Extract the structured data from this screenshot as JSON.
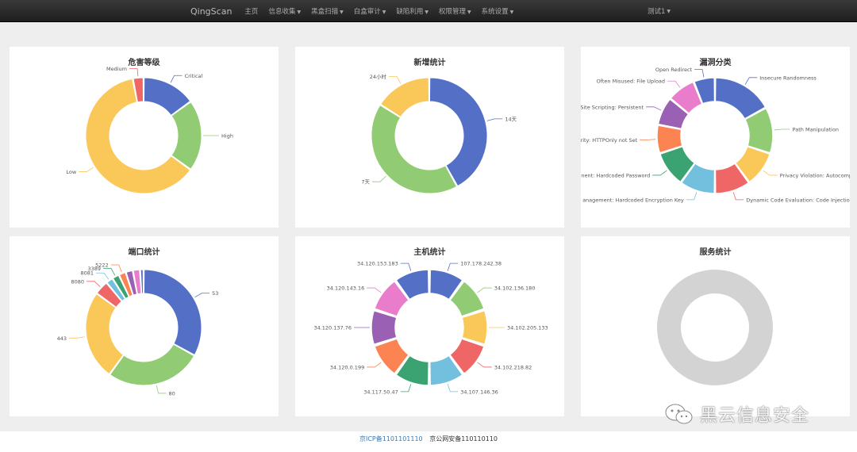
{
  "navbar": {
    "brand": "QingScan",
    "items": [
      {
        "label": "主页",
        "dropdown": false
      },
      {
        "label": "信息收集",
        "dropdown": true
      },
      {
        "label": "黑盒扫描",
        "dropdown": true
      },
      {
        "label": "白盒审计",
        "dropdown": true
      },
      {
        "label": "缺陷利用",
        "dropdown": true
      },
      {
        "label": "权限管理",
        "dropdown": true
      },
      {
        "label": "系统设置",
        "dropdown": true
      }
    ],
    "user": "测试1"
  },
  "colors": {
    "palette": [
      "#5470c6",
      "#91cc75",
      "#fac858",
      "#ee6666",
      "#73c0de",
      "#3ba272",
      "#fc8452",
      "#9a60b4",
      "#ea7ccc"
    ],
    "empty": "#d3d3d3"
  },
  "cards": [
    {
      "title": "危害等级"
    },
    {
      "title": "新增统计"
    },
    {
      "title": "漏洞分类"
    },
    {
      "title": "端口统计"
    },
    {
      "title": "主机统计"
    },
    {
      "title": "服务统计"
    }
  ],
  "chart_data": [
    {
      "type": "pie",
      "title": "危害等级",
      "labels": [
        "Critical",
        "High",
        "Low",
        "Medium"
      ],
      "values": [
        15,
        20,
        62,
        3
      ]
    },
    {
      "type": "pie",
      "title": "新增统计",
      "labels": [
        "14天",
        "7天",
        "24小时"
      ],
      "values": [
        42,
        42,
        16
      ]
    },
    {
      "type": "pie",
      "title": "漏洞分类",
      "labels": [
        "Insecure Randomness",
        "Path Manipulation",
        "Privacy Violation: Autocompl",
        "Dynamic Code Evaluation: Code Injection",
        "anagement: Hardcoded Encryption Key",
        "nent: Hardcoded Password",
        "rity: HTTPOnly not Set",
        "-Site Scripting: Persistent",
        "Often Misused: File Upload",
        "Open Redirect"
      ],
      "values": [
        17,
        13,
        10,
        10,
        10,
        10,
        8,
        8,
        8,
        6
      ]
    },
    {
      "type": "pie",
      "title": "端口统计",
      "labels": [
        "53",
        "80",
        "443",
        "8080",
        "8081",
        "3389",
        "5222",
        "",
        "",
        ""
      ],
      "values": [
        33,
        27,
        25,
        4,
        2,
        2,
        2,
        2,
        2,
        1
      ]
    },
    {
      "type": "pie",
      "title": "主机统计",
      "labels": [
        "107.178.242.38",
        "34.102.136.180",
        "34.102.205.133",
        "34.102.218.82",
        "34.107.146.36",
        "34.117.50.47",
        "34.120.0.199",
        "34.120.137.76",
        "34.120.143.16",
        "34.120.153.183"
      ],
      "values": [
        1,
        1,
        1,
        1,
        1,
        1,
        1,
        1,
        1,
        1
      ]
    },
    {
      "type": "pie",
      "title": "服务统计",
      "labels": [],
      "values": []
    }
  ],
  "footer": {
    "icp": "京ICP备1101101110",
    "psb": "京公网安备110110110"
  },
  "watermark": {
    "text": "黑云信息安全"
  }
}
